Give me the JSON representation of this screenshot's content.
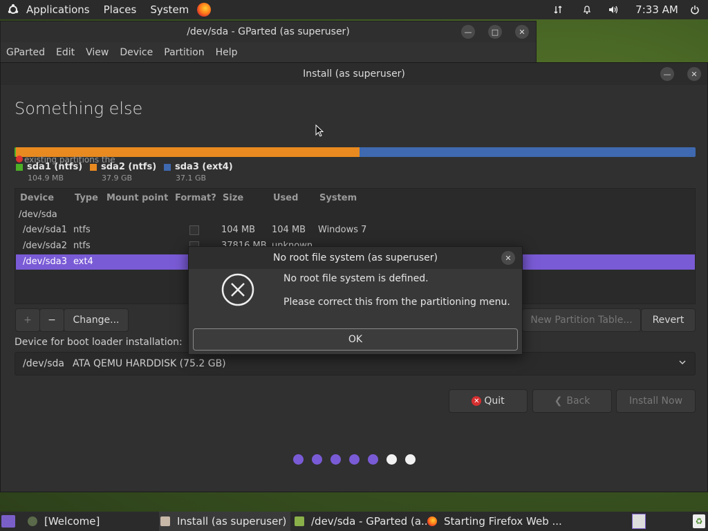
{
  "panel": {
    "menus": [
      "Applications",
      "Places",
      "System"
    ],
    "time": "7:33 AM"
  },
  "gparted": {
    "title": "/dev/sda - GParted (as superuser)",
    "menus": [
      "GParted",
      "Edit",
      "View",
      "Device",
      "Partition",
      "Help"
    ]
  },
  "install": {
    "title": "Install (as superuser)",
    "heading": "Something else",
    "obscured_text": "existing partitions the",
    "partitions": [
      {
        "name": "sda1 (ntfs)",
        "size": "104.9 MB",
        "color": "#4caf26",
        "fraction": 0.0014
      },
      {
        "name": "sda2 (ntfs)",
        "size": "37.9 GB",
        "color": "#e88a20",
        "fraction": 0.505
      },
      {
        "name": "sda3 (ext4)",
        "size": "37.1 GB",
        "color": "#3f69b0",
        "fraction": 0.4936
      }
    ],
    "table": {
      "headers": [
        "Device",
        "Type",
        "Mount point",
        "Format?",
        "Size",
        "Used",
        "System"
      ],
      "disk": "/dev/sda",
      "rows": [
        {
          "device": "/dev/sda1",
          "type": "ntfs",
          "size": "104 MB",
          "used": "104 MB",
          "system": "Windows 7"
        },
        {
          "device": "/dev/sda2",
          "type": "ntfs",
          "size": "37816 MB",
          "used": "unknown",
          "system": ""
        },
        {
          "device": "/dev/sda3",
          "type": "ext4",
          "size": "",
          "used": "",
          "system": ""
        }
      ]
    },
    "buttons": {
      "add": "+",
      "remove": "−",
      "change": "Change...",
      "new_table": "New Partition Table...",
      "revert": "Revert",
      "quit": "Quit",
      "back": "Back",
      "install_now": "Install Now"
    },
    "boot_label": "Device for boot loader installation:",
    "boot_device": "/dev/sda",
    "boot_desc": "ATA QEMU HARDDISK (75.2 GB)",
    "progress": {
      "total": 7,
      "done": 5
    }
  },
  "dialog": {
    "title": "No root file system (as superuser)",
    "line1": "No root file system is defined.",
    "line2": "Please correct this from the partitioning menu.",
    "ok": "OK"
  },
  "taskbar": {
    "items": [
      "[Welcome]",
      "Install (as superuser)",
      "/dev/sda - GParted (a...",
      "Starting Firefox Web ..."
    ]
  },
  "colors": {
    "selection": "#7a5bd6",
    "progress_dot": "#7a5bd6"
  }
}
